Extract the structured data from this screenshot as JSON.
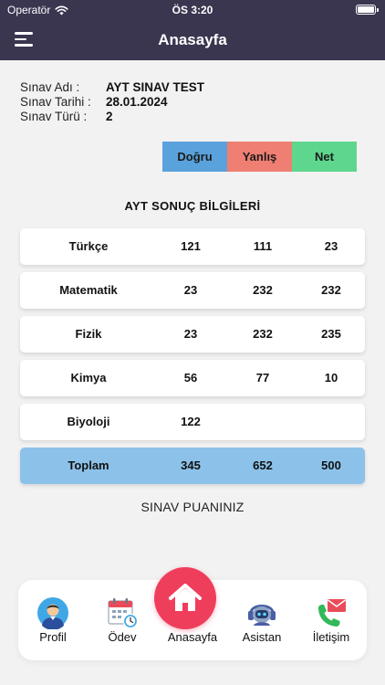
{
  "status": {
    "carrier": "Operatör",
    "time": "ÖS 3:20"
  },
  "header": {
    "title": "Anasayfa"
  },
  "exam": {
    "name_label": "Sınav Adı :",
    "name": "AYT SINAV TEST",
    "date_label": "Sınav Tarihi :",
    "date": "28.01.2024",
    "type_label": "Sınav Türü :",
    "type": "2"
  },
  "legend": {
    "correct": "Doğru",
    "wrong": "Yanlış",
    "net": "Net"
  },
  "results": {
    "title": "AYT SONUÇ BİLGİLERİ",
    "rows": [
      {
        "subject": "Türkçe",
        "correct": "121",
        "wrong": "111",
        "net": "23"
      },
      {
        "subject": "Matematik",
        "correct": "23",
        "wrong": "232",
        "net": "232"
      },
      {
        "subject": "Fizik",
        "correct": "23",
        "wrong": "232",
        "net": "235"
      },
      {
        "subject": "Kimya",
        "correct": "56",
        "wrong": "77",
        "net": "10"
      },
      {
        "subject": "Biyoloji",
        "correct": "122",
        "wrong": "",
        "net": ""
      }
    ],
    "total": {
      "subject": "Toplam",
      "correct": "345",
      "wrong": "652",
      "net": "500"
    }
  },
  "score": {
    "title": "SINAV PUANINIZ"
  },
  "tabs": {
    "profile": "Profil",
    "homework": "Ödev",
    "home": "Anasayfa",
    "assistant": "Asistan",
    "contact": "İletişim"
  },
  "colors": {
    "header": "#3a3650",
    "correct": "#5aa2dc",
    "wrong": "#ef7f72",
    "net": "#5ed68e",
    "total": "#8cc2e9",
    "home": "#ef3e5c"
  },
  "icons": {
    "menu": "hamburger-menu-icon",
    "home": "house-icon",
    "profile": "person-avatar-icon",
    "homework": "calendar-clock-icon",
    "assistant": "robot-headset-icon",
    "contact": "phone-mail-icon"
  }
}
